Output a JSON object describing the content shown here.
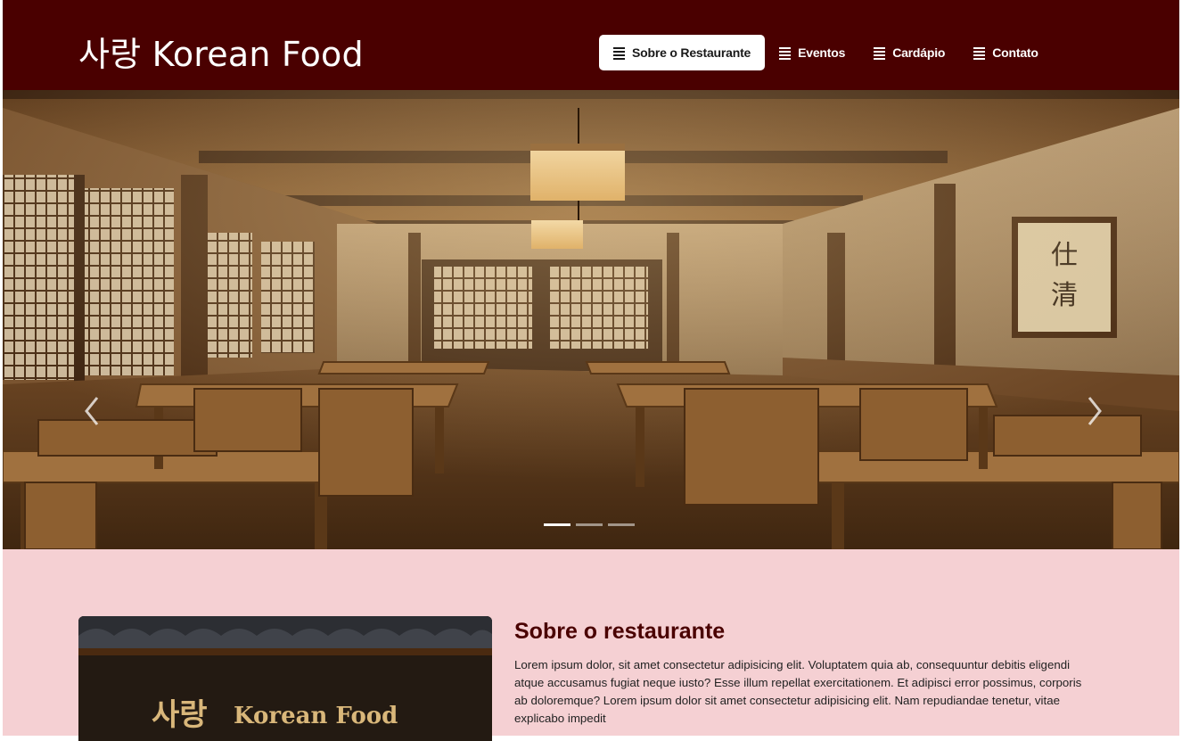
{
  "brand": {
    "title": "사랑 Korean Food"
  },
  "nav": {
    "items": [
      {
        "label": "Sobre o Restaurante",
        "icon": "list-icon",
        "active": true
      },
      {
        "label": "Eventos",
        "icon": "list-icon",
        "active": false
      },
      {
        "label": "Cardápio",
        "icon": "list-icon",
        "active": false
      },
      {
        "label": "Contato",
        "icon": "list-icon",
        "active": false
      }
    ]
  },
  "hero": {
    "slide_count": 3,
    "active_slide": 1,
    "scroll_sign": "仕清",
    "prev_icon": "chevron-left-icon",
    "next_icon": "chevron-right-icon"
  },
  "about": {
    "title": "Sobre o restaurante",
    "text": "Lorem ipsum dolor, sit amet consectetur adipisicing elit. Voluptatem quia ab, consequuntur debitis eligendi atque accusamus fugiat neque iusto? Esse illum repellat exercitationem. Et adipisci error possimus, corporis ab doloremque? Lorem ipsum dolor sit amet consectetur adipisicing elit. Nam repudiandae tenetur, vitae explicabo impedit",
    "image_sign": {
      "korean": "사랑",
      "latin": "Korean Food"
    }
  },
  "colors": {
    "header_bg": "#4a0000",
    "section_bg": "#f5d0d3",
    "title_color": "#4a0000",
    "sign_gold": "#d9b77a"
  }
}
